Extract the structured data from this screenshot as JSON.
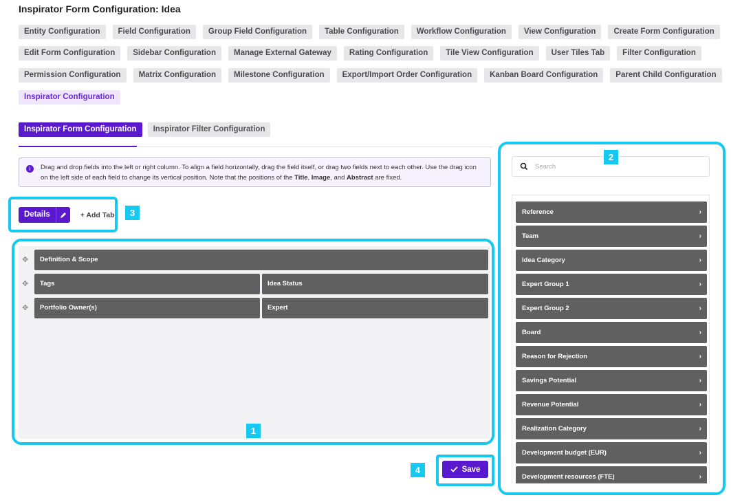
{
  "page": {
    "title": "Inspirator Form Configuration: Idea"
  },
  "config_tabs": {
    "row1": [
      "Entity Configuration",
      "Field Configuration",
      "Group Field Configuration",
      "Table Configuration",
      "Workflow Configuration",
      "View Configuration",
      "Create Form Configuration"
    ],
    "row2": [
      "Edit Form Configuration",
      "Sidebar Configuration",
      "Manage External Gateway",
      "Rating Configuration",
      "Tile View Configuration",
      "User Tiles Tab",
      "Filter Configuration"
    ],
    "row3": [
      "Permission Configuration",
      "Matrix Configuration",
      "Milestone Configuration",
      "Export/Import Order Configuration",
      "Kanban Board Configuration",
      "Parent Child Configuration"
    ],
    "row4": [
      "Inspirator Configuration"
    ]
  },
  "subtabs": {
    "form": "Inspirator Form Configuration",
    "filter": "Inspirator Filter Configuration"
  },
  "info": {
    "text_a": "Drag and drop fields into the left or right column. To align a field horizontally, drag the field itself, or drag two fields next to each other. Use the drag icon on the left side of each field to change its vertical position. Note that the positions of the ",
    "title": "Title",
    "sep1": ", ",
    "image": "Image",
    "sep2": ", and ",
    "abstract": "Abstract",
    "text_b": " are fixed."
  },
  "form_tabs": {
    "details": "Details",
    "add_tab": "+ Add Tab"
  },
  "form_rows": [
    {
      "full": "Definition & Scope"
    },
    {
      "left": "Tags",
      "right": "Idea Status"
    },
    {
      "left": "Portfolio Owner(s)",
      "right": "Expert"
    }
  ],
  "sidebar": {
    "search_placeholder": "Search",
    "fields": [
      "Reference",
      "Team",
      "Idea Category",
      "Expert Group 1",
      "Expert Group 2",
      "Board",
      "Reason for Rejection",
      "Savings Potential",
      "Revenue Potential",
      "Realization Category",
      "Development budget (EUR)",
      "Development resources (FTE)"
    ]
  },
  "actions": {
    "save": "Save"
  },
  "callouts": {
    "c1": "1",
    "c2": "2",
    "c3": "3",
    "c4": "4"
  },
  "colors": {
    "accent": "#5a18cf",
    "callout": "#17c8f0",
    "field": "#606060"
  },
  "icons": {
    "drag": "drag-handle-icon",
    "search": "search-icon",
    "edit": "pencil-icon",
    "save": "check-icon",
    "chevron": "chevron-right-icon",
    "info": "info-icon"
  }
}
